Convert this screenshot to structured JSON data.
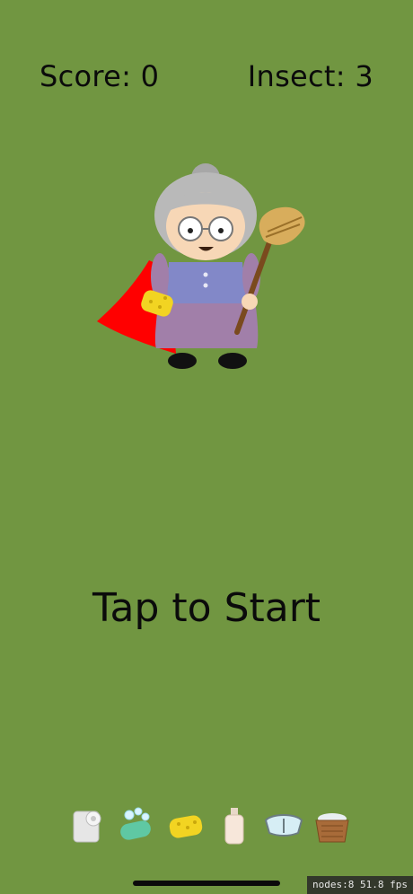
{
  "hud": {
    "score_label": "Score: 0",
    "insect_label": "Insect: 3"
  },
  "prompt": {
    "tap_to_start": "Tap to Start"
  },
  "toolbar": {
    "items": [
      {
        "icon": "toilet-paper-icon"
      },
      {
        "icon": "soap-bar-icon"
      },
      {
        "icon": "sponge-icon"
      },
      {
        "icon": "lotion-bottle-icon"
      },
      {
        "icon": "safety-goggles-icon"
      },
      {
        "icon": "laundry-basket-icon"
      }
    ]
  },
  "debug": {
    "stats": "nodes:8  51.8 fps"
  },
  "colors": {
    "background": "#719641",
    "text": "#0b0b0b",
    "cape": "#ff0000",
    "sponge": "#f2d422"
  }
}
